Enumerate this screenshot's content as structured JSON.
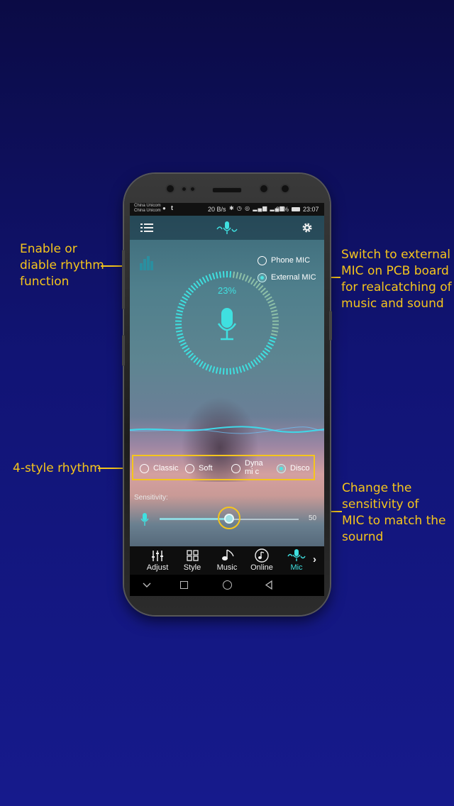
{
  "annotations": {
    "rhythm_toggle": [
      "Enable or",
      "diable rhythm",
      "function"
    ],
    "external_mic": [
      "Switch to external",
      "MIC on PCB board",
      "for realcatching of",
      "music and sound"
    ],
    "style_rhythm": [
      "4-style rhythm"
    ],
    "sensitivity": [
      "Change the",
      "sensitivity of",
      "MIC to match the",
      "sournd"
    ]
  },
  "status_bar": {
    "carrier1": "China Unicom",
    "carrier2": "China Unicom",
    "speed": "20 B/s",
    "battery": "82%",
    "time": "23:07"
  },
  "mic_source": {
    "options": [
      "Phone MIC",
      "External MIC"
    ],
    "selected": "External MIC"
  },
  "level": {
    "percent_text": "23%",
    "percent": 23
  },
  "rhythm_styles": {
    "options": [
      "Classic",
      "Soft",
      "Dynami c",
      "Disco"
    ],
    "selected": "Disco"
  },
  "sensitivity": {
    "label": "Sensitivity:",
    "value": 50,
    "value_text": "50",
    "max": 100
  },
  "bottom_nav": [
    {
      "label": "Adjust",
      "icon": "sliders-icon"
    },
    {
      "label": "Style",
      "icon": "grid-icon"
    },
    {
      "label": "Music",
      "icon": "music-note-icon"
    },
    {
      "label": "Online",
      "icon": "online-music-icon"
    },
    {
      "label": "Mic",
      "icon": "mic-wave-icon",
      "active": true
    }
  ],
  "colors": {
    "accent": "#3fe0e0",
    "annotation": "#f5c51c",
    "background_top": "#0b0b45",
    "background_bottom": "#161a8c"
  }
}
